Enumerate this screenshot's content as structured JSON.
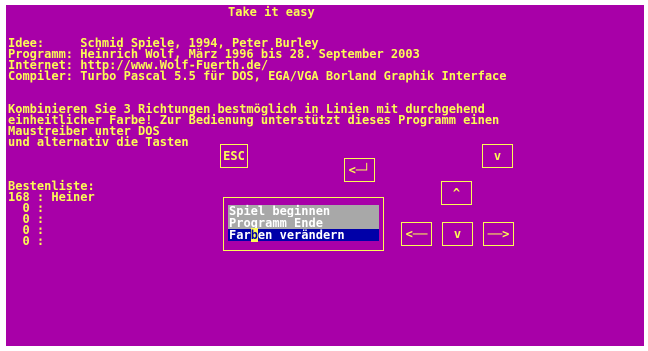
{
  "title": "Take it easy",
  "info": {
    "idee": "Idee:     Schmid Spiele, 1994, Peter Burley",
    "programm": "Programm: Heinrich Wolf, März 1996 bis 28. September 2003",
    "internet": "Internet: http://www.Wolf-Fuerth.de/",
    "compiler": "Compiler: Turbo Pascal 5.5 für DOS, EGA/VGA Borland Graphik Interface"
  },
  "description": {
    "line1": "Kombinieren Sie 3 Richtungen bestmöglich in Linien mit durchgehend",
    "line2": "einheitlicher Farbe! Zur Bedienung unterstützt dieses Programm einen",
    "line3": "Maustreiber unter DOS",
    "line4": "und alternativ die Tasten"
  },
  "highscores": {
    "heading": "Bestenliste:",
    "rows": [
      "168 : Heiner",
      "  0 :",
      "  0 :",
      "  0 :",
      "  0 :"
    ]
  },
  "keys": {
    "esc": "ESC",
    "enter": "<─┘",
    "v_top": "v",
    "up": "^",
    "left": "<──",
    "down": "v",
    "right": "──>"
  },
  "menu": {
    "item1": "Spiel beginnen",
    "item2": "Programm Ende",
    "item3_pre": "Far",
    "item3_cursor": "b",
    "item3_post": "en verändern"
  },
  "colors": {
    "background": "#a800a8",
    "text": "#fcfc54",
    "menu_grey": "#a8a8a8",
    "menu_selected": "#0000a8"
  }
}
